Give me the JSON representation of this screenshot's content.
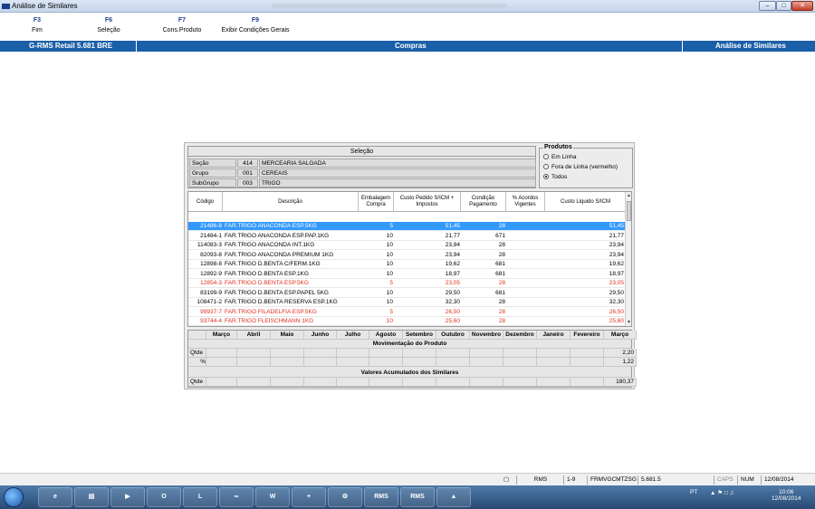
{
  "window": {
    "title": "Análise de Similares"
  },
  "fkeys": [
    {
      "key": "F3",
      "label": "Fim"
    },
    {
      "key": "F6",
      "label": "Seleção"
    },
    {
      "key": "F7",
      "label": "Cons.Produto"
    },
    {
      "key": "F9",
      "label": "Exibir Condições Gerais"
    }
  ],
  "header": {
    "left": "G-RMS Retail 5.681 BRE",
    "center": "Compras",
    "right": "Análise de Similares"
  },
  "selecao": {
    "title": "Seleção",
    "rows": [
      {
        "label": "Seção",
        "code": "414",
        "desc": "MERCEARIA SALGADA"
      },
      {
        "label": "Grupo",
        "code": "001",
        "desc": "CEREAIS"
      },
      {
        "label": "SubGrupo",
        "code": "003",
        "desc": "TRIGO"
      }
    ]
  },
  "produtos": {
    "title": "Produtos",
    "options": [
      {
        "label": "Em Linha",
        "selected": false
      },
      {
        "label": "Fora de Linha (vermelho)",
        "selected": false
      },
      {
        "label": "Todos",
        "selected": true
      }
    ]
  },
  "grid": {
    "headers": [
      "Código",
      "Descrição",
      "Embalagem Compra",
      "Custo Pedido S/ICM + Impostos",
      "Condição Pagamento",
      "% Acordos Vigentes",
      "Custo Liquido S/ICM"
    ],
    "rows": [
      {
        "codigo": "21486-8",
        "descricao": "FAR.TRIGO ANACONDA ESP.5KG",
        "embalagem": "5",
        "custo": "51,45",
        "condicao": "28",
        "acordos": "",
        "liquido": "51,45",
        "state": "sel"
      },
      {
        "codigo": "21484-1",
        "descricao": "FAR.TRIGO ANACONDA ESP.PAP.1KG",
        "embalagem": "10",
        "custo": "21,77",
        "condicao": "671",
        "acordos": "",
        "liquido": "21,77",
        "state": "normal"
      },
      {
        "codigo": "114083-3",
        "descricao": "FAR.TRIGO ANACONDA INT.1KG",
        "embalagem": "10",
        "custo": "23,94",
        "condicao": "28",
        "acordos": "",
        "liquido": "23,94",
        "state": "normal"
      },
      {
        "codigo": "82093-8",
        "descricao": "FAR.TRIGO ANACONDA PREMIUM 1KG",
        "embalagem": "10",
        "custo": "23,94",
        "condicao": "28",
        "acordos": "",
        "liquido": "23,94",
        "state": "normal"
      },
      {
        "codigo": "12898-8",
        "descricao": "FAR.TRIGO D.BENTA C/FERM.1KG",
        "embalagem": "10",
        "custo": "19,62",
        "condicao": "681",
        "acordos": "",
        "liquido": "19,62",
        "state": "normal"
      },
      {
        "codigo": "12892-9",
        "descricao": "FAR.TRIGO D.BENTA ESP.1KG",
        "embalagem": "10",
        "custo": "18,97",
        "condicao": "681",
        "acordos": "",
        "liquido": "18,97",
        "state": "normal"
      },
      {
        "codigo": "12854-3",
        "descricao": "FAR.TRIGO D.BENTA ESP.5KG",
        "embalagem": "5",
        "custo": "23,05",
        "condicao": "28",
        "acordos": "",
        "liquido": "23,05",
        "state": "red"
      },
      {
        "codigo": "83199-9",
        "descricao": "FAR.TRIGO D.BENTA ESP.PAPEL 5KG",
        "embalagem": "10",
        "custo": "29,50",
        "condicao": "681",
        "acordos": "",
        "liquido": "29,50",
        "state": "normal"
      },
      {
        "codigo": "108471-2",
        "descricao": "FAR.TRIGO D.BENTA RESERVA ESP.1KG",
        "embalagem": "10",
        "custo": "32,30",
        "condicao": "28",
        "acordos": "",
        "liquido": "32,30",
        "state": "normal"
      },
      {
        "codigo": "99937-7",
        "descricao": "FAR.TRIGO FILADELFIA ESP.5KG",
        "embalagem": "5",
        "custo": "26,50",
        "condicao": "28",
        "acordos": "",
        "liquido": "26,50",
        "state": "red"
      },
      {
        "codigo": "93744-4",
        "descricao": "FAR.TRIGO FLEISCHMANN 1KG",
        "embalagem": "10",
        "custo": "25,60",
        "condicao": "28",
        "acordos": "",
        "liquido": "25,60",
        "state": "red"
      }
    ]
  },
  "months": {
    "headers": [
      "Março",
      "Abril",
      "Maio",
      "Junho",
      "Julho",
      "Agosto",
      "Setembro",
      "Outubro",
      "Novembro",
      "Dezembro",
      "Janeiro",
      "Fevereiro",
      "Março"
    ],
    "section1": "Movimentação do Produto",
    "row_qtde": "Qtde",
    "row_pct": "%",
    "qtde_last": "2,20",
    "pct_last": "1,22",
    "section2": "Valores Acumulados dos Similares",
    "acum_label": "Qtde",
    "acum_last": "180,37"
  },
  "statusbar": {
    "app": "RMS",
    "page": "1-9",
    "form": "FRMVGCMTZSG",
    "version": "5.681.5",
    "caps": "CAPS",
    "num": "NUM",
    "date": "12/08/2014"
  },
  "taskbar": {
    "time": "10:06",
    "date": "12/08/2014",
    "lang": "PT",
    "items": [
      "RMS",
      "RMS"
    ]
  }
}
